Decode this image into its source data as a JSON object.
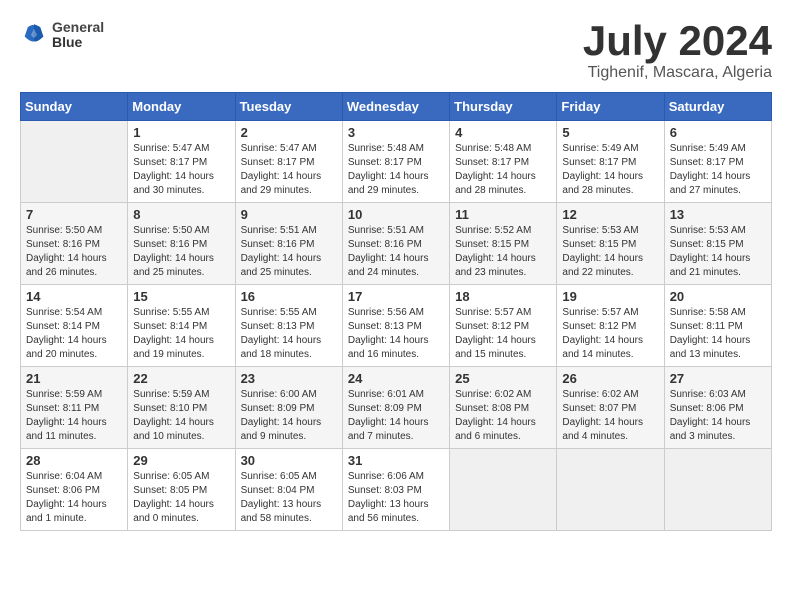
{
  "header": {
    "logo_line1": "General",
    "logo_line2": "Blue",
    "title": "July 2024",
    "subtitle": "Tighenif, Mascara, Algeria"
  },
  "weekdays": [
    "Sunday",
    "Monday",
    "Tuesday",
    "Wednesday",
    "Thursday",
    "Friday",
    "Saturday"
  ],
  "weeks": [
    [
      {
        "day": "",
        "sunrise": "",
        "sunset": "",
        "daylight": ""
      },
      {
        "day": "1",
        "sunrise": "Sunrise: 5:47 AM",
        "sunset": "Sunset: 8:17 PM",
        "daylight": "Daylight: 14 hours and 30 minutes."
      },
      {
        "day": "2",
        "sunrise": "Sunrise: 5:47 AM",
        "sunset": "Sunset: 8:17 PM",
        "daylight": "Daylight: 14 hours and 29 minutes."
      },
      {
        "day": "3",
        "sunrise": "Sunrise: 5:48 AM",
        "sunset": "Sunset: 8:17 PM",
        "daylight": "Daylight: 14 hours and 29 minutes."
      },
      {
        "day": "4",
        "sunrise": "Sunrise: 5:48 AM",
        "sunset": "Sunset: 8:17 PM",
        "daylight": "Daylight: 14 hours and 28 minutes."
      },
      {
        "day": "5",
        "sunrise": "Sunrise: 5:49 AM",
        "sunset": "Sunset: 8:17 PM",
        "daylight": "Daylight: 14 hours and 28 minutes."
      },
      {
        "day": "6",
        "sunrise": "Sunrise: 5:49 AM",
        "sunset": "Sunset: 8:17 PM",
        "daylight": "Daylight: 14 hours and 27 minutes."
      }
    ],
    [
      {
        "day": "7",
        "sunrise": "Sunrise: 5:50 AM",
        "sunset": "Sunset: 8:16 PM",
        "daylight": "Daylight: 14 hours and 26 minutes."
      },
      {
        "day": "8",
        "sunrise": "Sunrise: 5:50 AM",
        "sunset": "Sunset: 8:16 PM",
        "daylight": "Daylight: 14 hours and 25 minutes."
      },
      {
        "day": "9",
        "sunrise": "Sunrise: 5:51 AM",
        "sunset": "Sunset: 8:16 PM",
        "daylight": "Daylight: 14 hours and 25 minutes."
      },
      {
        "day": "10",
        "sunrise": "Sunrise: 5:51 AM",
        "sunset": "Sunset: 8:16 PM",
        "daylight": "Daylight: 14 hours and 24 minutes."
      },
      {
        "day": "11",
        "sunrise": "Sunrise: 5:52 AM",
        "sunset": "Sunset: 8:15 PM",
        "daylight": "Daylight: 14 hours and 23 minutes."
      },
      {
        "day": "12",
        "sunrise": "Sunrise: 5:53 AM",
        "sunset": "Sunset: 8:15 PM",
        "daylight": "Daylight: 14 hours and 22 minutes."
      },
      {
        "day": "13",
        "sunrise": "Sunrise: 5:53 AM",
        "sunset": "Sunset: 8:15 PM",
        "daylight": "Daylight: 14 hours and 21 minutes."
      }
    ],
    [
      {
        "day": "14",
        "sunrise": "Sunrise: 5:54 AM",
        "sunset": "Sunset: 8:14 PM",
        "daylight": "Daylight: 14 hours and 20 minutes."
      },
      {
        "day": "15",
        "sunrise": "Sunrise: 5:55 AM",
        "sunset": "Sunset: 8:14 PM",
        "daylight": "Daylight: 14 hours and 19 minutes."
      },
      {
        "day": "16",
        "sunrise": "Sunrise: 5:55 AM",
        "sunset": "Sunset: 8:13 PM",
        "daylight": "Daylight: 14 hours and 18 minutes."
      },
      {
        "day": "17",
        "sunrise": "Sunrise: 5:56 AM",
        "sunset": "Sunset: 8:13 PM",
        "daylight": "Daylight: 14 hours and 16 minutes."
      },
      {
        "day": "18",
        "sunrise": "Sunrise: 5:57 AM",
        "sunset": "Sunset: 8:12 PM",
        "daylight": "Daylight: 14 hours and 15 minutes."
      },
      {
        "day": "19",
        "sunrise": "Sunrise: 5:57 AM",
        "sunset": "Sunset: 8:12 PM",
        "daylight": "Daylight: 14 hours and 14 minutes."
      },
      {
        "day": "20",
        "sunrise": "Sunrise: 5:58 AM",
        "sunset": "Sunset: 8:11 PM",
        "daylight": "Daylight: 14 hours and 13 minutes."
      }
    ],
    [
      {
        "day": "21",
        "sunrise": "Sunrise: 5:59 AM",
        "sunset": "Sunset: 8:11 PM",
        "daylight": "Daylight: 14 hours and 11 minutes."
      },
      {
        "day": "22",
        "sunrise": "Sunrise: 5:59 AM",
        "sunset": "Sunset: 8:10 PM",
        "daylight": "Daylight: 14 hours and 10 minutes."
      },
      {
        "day": "23",
        "sunrise": "Sunrise: 6:00 AM",
        "sunset": "Sunset: 8:09 PM",
        "daylight": "Daylight: 14 hours and 9 minutes."
      },
      {
        "day": "24",
        "sunrise": "Sunrise: 6:01 AM",
        "sunset": "Sunset: 8:09 PM",
        "daylight": "Daylight: 14 hours and 7 minutes."
      },
      {
        "day": "25",
        "sunrise": "Sunrise: 6:02 AM",
        "sunset": "Sunset: 8:08 PM",
        "daylight": "Daylight: 14 hours and 6 minutes."
      },
      {
        "day": "26",
        "sunrise": "Sunrise: 6:02 AM",
        "sunset": "Sunset: 8:07 PM",
        "daylight": "Daylight: 14 hours and 4 minutes."
      },
      {
        "day": "27",
        "sunrise": "Sunrise: 6:03 AM",
        "sunset": "Sunset: 8:06 PM",
        "daylight": "Daylight: 14 hours and 3 minutes."
      }
    ],
    [
      {
        "day": "28",
        "sunrise": "Sunrise: 6:04 AM",
        "sunset": "Sunset: 8:06 PM",
        "daylight": "Daylight: 14 hours and 1 minute."
      },
      {
        "day": "29",
        "sunrise": "Sunrise: 6:05 AM",
        "sunset": "Sunset: 8:05 PM",
        "daylight": "Daylight: 14 hours and 0 minutes."
      },
      {
        "day": "30",
        "sunrise": "Sunrise: 6:05 AM",
        "sunset": "Sunset: 8:04 PM",
        "daylight": "Daylight: 13 hours and 58 minutes."
      },
      {
        "day": "31",
        "sunrise": "Sunrise: 6:06 AM",
        "sunset": "Sunset: 8:03 PM",
        "daylight": "Daylight: 13 hours and 56 minutes."
      },
      {
        "day": "",
        "sunrise": "",
        "sunset": "",
        "daylight": ""
      },
      {
        "day": "",
        "sunrise": "",
        "sunset": "",
        "daylight": ""
      },
      {
        "day": "",
        "sunrise": "",
        "sunset": "",
        "daylight": ""
      }
    ]
  ]
}
